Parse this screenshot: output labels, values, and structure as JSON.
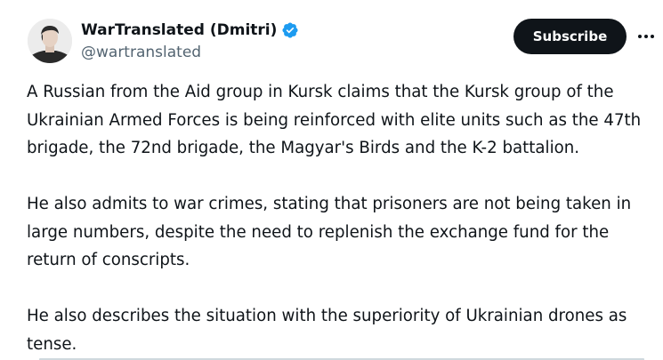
{
  "author": {
    "display_name": "WarTranslated (Dmitri)",
    "handle": "@wartranslated",
    "verified": true,
    "avatar_icon": "person-portrait"
  },
  "actions": {
    "subscribe_label": "Subscribe",
    "more_icon": "more-horizontal-icon"
  },
  "tweet": {
    "paragraphs": [
      "A Russian from the Aid group in Kursk claims that the Kursk group of the Ukrainian Armed Forces is being reinforced with elite units such as the 47th brigade, the 72nd brigade, the Magyar's Birds and the K-2 battalion.",
      "He also admits to war crimes, stating that prisoners are not being taken in large numbers, despite the need to replenish the exchange fund for the return of conscripts.",
      "He also describes the situation with the superiority of Ukrainian drones as tense."
    ]
  },
  "colors": {
    "text": "#0f1419",
    "secondary_text": "#536471",
    "verified_blue": "#1d9bf0",
    "button_bg": "#0f1419",
    "button_text": "#ffffff",
    "border": "#cfd9de"
  }
}
